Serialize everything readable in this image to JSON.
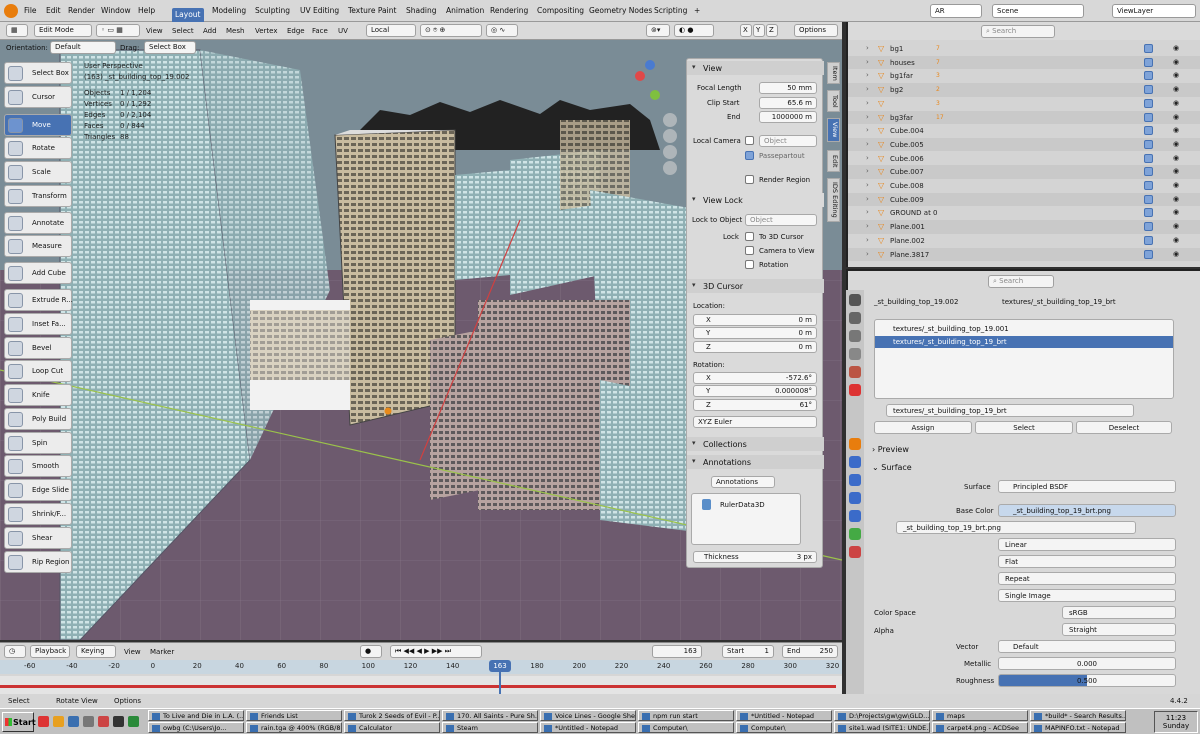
{
  "menu": {
    "items": [
      "File",
      "Edit",
      "Render",
      "Window",
      "Help"
    ],
    "workspaces": [
      "Layout",
      "Modeling",
      "Sculpting",
      "UV Editing",
      "Texture Paint",
      "Shading",
      "Animation",
      "Rendering",
      "Compositing",
      "Geometry Nodes",
      "Scripting"
    ],
    "add_tab": "+",
    "engine": "AR",
    "scene": "Scene",
    "view_layer": "ViewLayer"
  },
  "viewport_header": {
    "mode": "Edit Mode",
    "menus": [
      "View",
      "Select",
      "Add",
      "Mesh",
      "Vertex",
      "Edge",
      "Face",
      "UV"
    ],
    "transform_orientation": "Local",
    "axes": [
      "X",
      "Y",
      "Z"
    ],
    "options": "Options",
    "orientation_label": "Orientation:",
    "orientation_value": "Default",
    "drag_label": "Drag:",
    "drag_value": "Select Box"
  },
  "overlay_info": {
    "view": "User Perspective",
    "object": "(163) _st_building_top_19.002",
    "stats": [
      {
        "label": "Objects",
        "value": "1 / 1,204"
      },
      {
        "label": "Vertices",
        "value": "0 / 1,292"
      },
      {
        "label": "Edges",
        "value": "0 / 2,104"
      },
      {
        "label": "Faces",
        "value": "0 / 844"
      },
      {
        "label": "Triangles",
        "value": "88"
      }
    ]
  },
  "tools": [
    "Select Box",
    "Cursor",
    "Move",
    "Rotate",
    "Scale",
    "Transform",
    "Annotate",
    "Measure",
    "Add Cube",
    "Extrude R...",
    "Inset Fa...",
    "Bevel",
    "Loop Cut",
    "Knife",
    "Poly Build",
    "Spin",
    "Smooth",
    "Edge Slide",
    "Shrink/F...",
    "Shear",
    "Rip Region"
  ],
  "active_tool": "Move",
  "npanel": {
    "view_title": "View",
    "focal_length_label": "Focal Length",
    "focal_length": "50 mm",
    "clip_start_label": "Clip Start",
    "clip_start": "65.6 m",
    "clip_end_label": "End",
    "clip_end": "1000000 m",
    "local_camera_label": "Local Camera",
    "object_placeholder": "Object",
    "passepartout": "Passepartout",
    "render_region": "Render Region",
    "view_lock_title": "View Lock",
    "lock_to_object_label": "Lock to Object",
    "lock_label": "Lock",
    "to_3d_cursor": "To 3D Cursor",
    "camera_to_view": "Camera to View",
    "rotation_lock": "Rotation",
    "cursor_title": "3D Cursor",
    "location_label": "Location:",
    "loc": [
      {
        "axis": "X",
        "value": "0 m"
      },
      {
        "axis": "Y",
        "value": "0 m"
      },
      {
        "axis": "Z",
        "value": "0 m"
      }
    ],
    "rotation_label": "Rotation:",
    "rot": [
      {
        "axis": "X",
        "value": "-572.6°"
      },
      {
        "axis": "Y",
        "value": "0.000008°"
      },
      {
        "axis": "Z",
        "value": "61°"
      }
    ],
    "rotation_mode": "XYZ Euler",
    "collections_title": "Collections",
    "annotations_title": "Annotations",
    "annotations_field": "Annotations",
    "annotation_layer": "RulerData3D",
    "thickness_label": "Thickness",
    "thickness_value": "3 px",
    "vtabs": [
      "Item",
      "Tool",
      "View",
      "Edit",
      "IDS Editing"
    ]
  },
  "outliner": {
    "search_placeholder": "Search",
    "rows": [
      {
        "name": "bg1",
        "count": "7"
      },
      {
        "name": "houses",
        "count": "7"
      },
      {
        "name": "bg1far",
        "count": "3"
      },
      {
        "name": "bg2",
        "count": "2"
      },
      {
        "name": "",
        "count": "3"
      },
      {
        "name": "bg3far",
        "count": "17"
      },
      {
        "name": "Cube.004",
        "count": ""
      },
      {
        "name": "Cube.005",
        "count": ""
      },
      {
        "name": "Cube.006",
        "count": ""
      },
      {
        "name": "Cube.007",
        "count": ""
      },
      {
        "name": "Cube.008",
        "count": ""
      },
      {
        "name": "Cube.009",
        "count": ""
      },
      {
        "name": "GROUND at 0",
        "count": ""
      },
      {
        "name": "Plane.001",
        "count": ""
      },
      {
        "name": "Plane.002",
        "count": ""
      },
      {
        "name": "Plane.3817",
        "count": ""
      }
    ]
  },
  "properties": {
    "search_placeholder": "Search",
    "breadcrumb_object": "_st_building_top_19.002",
    "breadcrumb_material": "textures/_st_building_top_19_brt",
    "slots": [
      "textures/_st_building_top_19.001",
      "textures/_st_building_top_19_brt"
    ],
    "material_name": "textures/_st_building_top_19_brt",
    "assign": "Assign",
    "select": "Select",
    "deselect": "Deselect",
    "preview": "Preview",
    "surface_panel": "Surface",
    "surface_label": "Surface",
    "surface_value": "Principled BSDF",
    "base_color_label": "Base Color",
    "base_color_value": "_st_building_top_19_brt.png",
    "image_name": "_st_building_top_19_brt.png",
    "interp": "Linear",
    "projection": "Flat",
    "extension": "Repeat",
    "source": "Single Image",
    "color_space_label": "Color Space",
    "color_space": "sRGB",
    "alpha_label": "Alpha",
    "alpha_value": "Straight",
    "vector_label": "Vector",
    "vector_value": "Default",
    "metallic_label": "Metallic",
    "metallic_value": "0.000",
    "roughness_label": "Roughness",
    "roughness_value": "0.500"
  },
  "timeline": {
    "playback": "Playback",
    "keying": "Keying",
    "view": "View",
    "marker": "Marker",
    "current_frame": "163",
    "start_label": "Start",
    "start": "1",
    "end_label": "End",
    "end": "250",
    "ticks": [
      "-60",
      "-40",
      "-20",
      "0",
      "20",
      "40",
      "60",
      "80",
      "100",
      "120",
      "140",
      "163",
      "180",
      "200",
      "220",
      "240",
      "260",
      "280",
      "300",
      "320"
    ]
  },
  "statusbar": {
    "select": "Select",
    "rotate_view": "Rotate View",
    "options": "Options",
    "version": "4.4.2"
  },
  "taskbar": {
    "start": "Start",
    "row1": [
      "To Live and Die in L.A. (...",
      "Friends List",
      "Turok 2 Seeds of Evil - P...",
      "170. All Saints - Pure Sh...",
      "Voice Lines - Google She...",
      "npm run start",
      "*Untitled - Notepad",
      "D:\\Projects\\gw\\gw\\GLD...",
      "maps",
      "*build* - Search Results..."
    ],
    "row2": [
      "owbg (C:\\Users\\Jo...",
      "rain.tga @ 400% (RGB/8)",
      "Calculator",
      "Steam",
      "*Untitled - Notepad",
      "Computer\\",
      "Computer\\",
      "site1.wad (SITE1: UNDE...",
      "carpet4.png - ACDSee",
      "MAPINFO.txt - Notepad"
    ],
    "time": "11:23",
    "day": "Sunday"
  },
  "colors": {
    "accent": "#4772b3",
    "orange": "#e87d0d",
    "viewport_floor": "#6d5a6e"
  }
}
